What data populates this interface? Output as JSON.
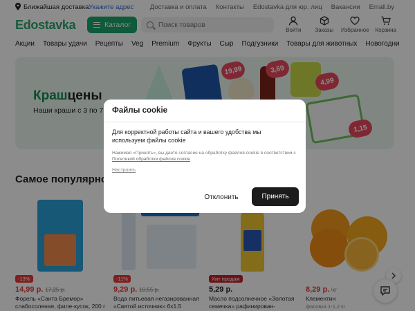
{
  "topbar": {
    "delivery_label": "Ближайшая доставка",
    "address_link": "Укажите адрес",
    "links": [
      "Доставка и оплата",
      "Контакты",
      "Edostavka для юр. лиц",
      "Вакансии",
      "Emall.by"
    ]
  },
  "header": {
    "logo": "Edostavka",
    "catalog_label": "Каталог",
    "search_placeholder": "Поиск товаров",
    "icons": [
      {
        "name": "user-icon",
        "label": "Войти"
      },
      {
        "name": "box-icon",
        "label": "Заказы"
      },
      {
        "name": "heart-icon",
        "label": "Избранное"
      },
      {
        "name": "cart-icon",
        "label": "Корзина"
      }
    ]
  },
  "categories": [
    "Акции",
    "Товары удачи",
    "Рецепты",
    "Veg",
    "Premium",
    "Фрукты",
    "Сыр",
    "Подгузники",
    "Товары для животных",
    "Новогодние"
  ],
  "banner": {
    "title_part1": "Краш",
    "title_part2": "цены",
    "subtitle": "Наши краши с 3 по 7",
    "price_tags": [
      "19,99",
      "3,69",
      "4,99",
      "1,15"
    ],
    "colors": {
      "title_green": "#168a54",
      "tag_red": "#e84a5f"
    }
  },
  "section": {
    "title": "Самое популярное"
  },
  "products": [
    {
      "badge": "-13%",
      "badge_color": "#e63a3a",
      "price": "14,99 р.",
      "old_price": "17,25 р.",
      "unit": "",
      "name": "Форель «Санта Бремор» слабосоленая, филе-кусок, 200 г",
      "price_red": true
    },
    {
      "badge": "-11%",
      "badge_color": "#e63a3a",
      "price": "9,29 р.",
      "old_price": "10,55 р.",
      "unit": "",
      "name": "Вода питьевая негазированная «Святой источник» 6х1.5",
      "price_red": true
    },
    {
      "badge": "Хит продаж",
      "badge_color": "#c2262b",
      "price": "5,29 р.",
      "old_price": "",
      "unit": "",
      "name": "Масло подсолнечное «Золотая семечка» рафинирован-",
      "price_red": false
    },
    {
      "badge": "",
      "badge_color": "",
      "price": "8,29 р.",
      "old_price": "",
      "unit": "/кг",
      "name": "Клементин",
      "sub": "фасовка 1-1,2 кг",
      "price_red": true
    }
  ],
  "cookie_modal": {
    "title": "Файлы cookie",
    "text": "Для корректной работы сайта и вашего удобства мы используем файлы cookie",
    "note_prefix": "Нажимая «Принять», вы даете согласие на обработку файлов cookie в соответствии с ",
    "note_link": "Политикой обработки файлов cookie",
    "settings_link": "Настроить",
    "reject_label": "Отклонить",
    "accept_label": "Принять"
  }
}
